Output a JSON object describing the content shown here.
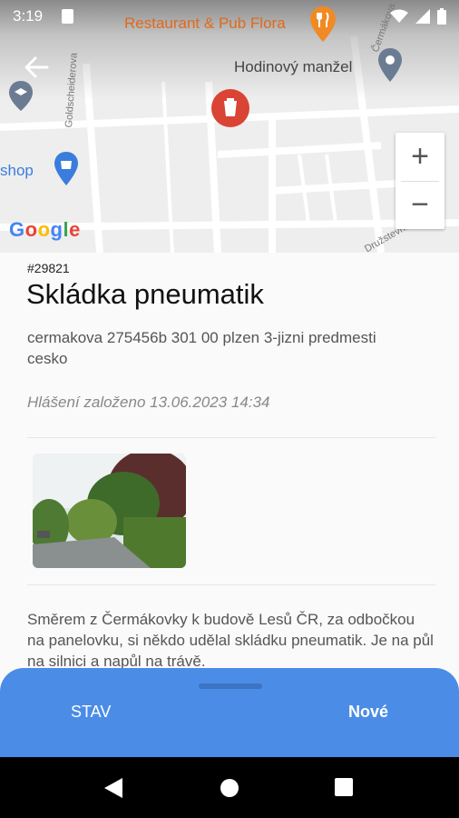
{
  "status_bar": {
    "time": "3:19"
  },
  "map": {
    "poi_restaurant": "Restaurant & Pub Flora",
    "poi_hodinovy": "Hodinový manžel",
    "poi_shop": "shop",
    "street_goldscheiderova": "Goldscheiderova",
    "street_cermakova": "Čermákova",
    "street_druzstevni": "Družstevní",
    "zoom_in": "+",
    "zoom_out": "−",
    "google_logo": "Google"
  },
  "report": {
    "id": "#29821",
    "title": "Skládka pneumatik",
    "address": "cermakova 275456b 301 00 plzen 3-jizni predmesti cesko",
    "created": "Hlášení založeno 13.06.2023 14:34",
    "description": "Směrem z Čermákovky k budově Lesů ČR, za odbočkou na panelovku, si někdo udělal skládku pneumatik. Je na půl na silnici a napůl na trávě."
  },
  "bottom_sheet": {
    "status_label": "STAV",
    "status_value": "Nové"
  },
  "colors": {
    "accent": "#4a8ce6",
    "marker": "#d94434"
  }
}
